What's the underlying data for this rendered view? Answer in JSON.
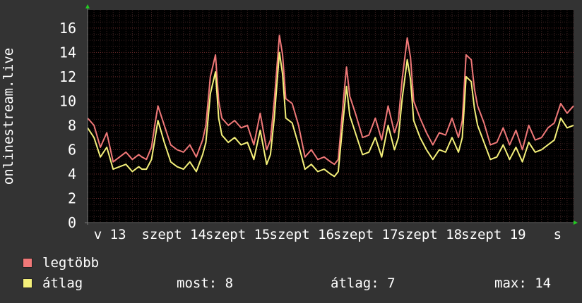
{
  "chart_data": {
    "type": "line",
    "ylabel": "onlinestream.live",
    "ylim": [
      0,
      17.5
    ],
    "yticks": [
      0,
      2,
      4,
      6,
      8,
      10,
      12,
      14,
      16
    ],
    "xlim": [
      0,
      7.6
    ],
    "xtick_labels": [
      {
        "x": 0.35,
        "label": "v 13"
      },
      {
        "x": 1.35,
        "label": "szept 14"
      },
      {
        "x": 2.35,
        "label": "szept 15"
      },
      {
        "x": 3.35,
        "label": "szept 16"
      },
      {
        "x": 4.35,
        "label": "szept 17"
      },
      {
        "x": 5.35,
        "label": "szept 18"
      },
      {
        "x": 6.35,
        "label": "szept 19"
      },
      {
        "x": 7.35,
        "label": "s"
      }
    ],
    "grid": true,
    "series": [
      {
        "name": "legtöbb",
        "color": "#f07878",
        "x": [
          0.0,
          0.1,
          0.2,
          0.3,
          0.4,
          0.5,
          0.6,
          0.7,
          0.8,
          0.85,
          0.92,
          1.0,
          1.05,
          1.1,
          1.2,
          1.3,
          1.4,
          1.5,
          1.6,
          1.7,
          1.8,
          1.85,
          1.92,
          2.0,
          2.05,
          2.1,
          2.2,
          2.3,
          2.4,
          2.5,
          2.6,
          2.7,
          2.8,
          2.86,
          2.92,
          3.0,
          3.05,
          3.1,
          3.2,
          3.3,
          3.4,
          3.5,
          3.6,
          3.7,
          3.8,
          3.86,
          3.92,
          4.0,
          4.05,
          4.1,
          4.2,
          4.3,
          4.4,
          4.5,
          4.6,
          4.7,
          4.8,
          4.86,
          4.92,
          5.0,
          5.05,
          5.1,
          5.2,
          5.3,
          5.4,
          5.5,
          5.6,
          5.7,
          5.8,
          5.86,
          5.92,
          6.0,
          6.05,
          6.1,
          6.2,
          6.3,
          6.4,
          6.5,
          6.6,
          6.7,
          6.8,
          6.9,
          7.0,
          7.1,
          7.2,
          7.3,
          7.4,
          7.5,
          7.6
        ],
        "values": [
          8.6,
          8.0,
          6.2,
          7.4,
          5.0,
          5.4,
          5.8,
          5.2,
          5.6,
          5.4,
          5.2,
          6.2,
          8.0,
          9.6,
          8.0,
          6.4,
          6.0,
          5.8,
          6.4,
          5.4,
          6.8,
          8.0,
          12.0,
          13.8,
          10.0,
          8.6,
          8.0,
          8.4,
          7.8,
          8.0,
          6.4,
          9.0,
          6.0,
          6.8,
          10.0,
          15.4,
          13.8,
          10.2,
          9.8,
          8.0,
          5.4,
          6.0,
          5.2,
          5.4,
          5.0,
          4.8,
          5.2,
          10.0,
          12.8,
          10.4,
          8.8,
          7.0,
          7.2,
          8.6,
          6.8,
          9.6,
          7.4,
          8.4,
          11.8,
          15.2,
          13.6,
          10.0,
          8.6,
          7.4,
          6.4,
          7.4,
          7.2,
          8.6,
          7.0,
          8.4,
          13.8,
          13.4,
          11.0,
          9.6,
          8.2,
          6.4,
          6.6,
          7.8,
          6.4,
          7.6,
          6.0,
          8.0,
          6.8,
          7.0,
          7.8,
          8.2,
          9.8,
          9.0,
          9.6
        ]
      },
      {
        "name": "átlag",
        "color": "#f4f07a",
        "x": [
          0.0,
          0.1,
          0.2,
          0.3,
          0.4,
          0.5,
          0.6,
          0.7,
          0.8,
          0.85,
          0.92,
          1.0,
          1.05,
          1.1,
          1.2,
          1.3,
          1.4,
          1.5,
          1.6,
          1.7,
          1.8,
          1.85,
          1.92,
          2.0,
          2.05,
          2.1,
          2.2,
          2.3,
          2.4,
          2.5,
          2.6,
          2.7,
          2.8,
          2.86,
          2.92,
          3.0,
          3.05,
          3.1,
          3.2,
          3.3,
          3.4,
          3.5,
          3.6,
          3.7,
          3.8,
          3.86,
          3.92,
          4.0,
          4.05,
          4.1,
          4.2,
          4.3,
          4.4,
          4.5,
          4.6,
          4.7,
          4.8,
          4.86,
          4.92,
          5.0,
          5.05,
          5.1,
          5.2,
          5.3,
          5.4,
          5.5,
          5.6,
          5.7,
          5.8,
          5.86,
          5.92,
          6.0,
          6.05,
          6.1,
          6.2,
          6.3,
          6.4,
          6.5,
          6.6,
          6.7,
          6.8,
          6.9,
          7.0,
          7.1,
          7.2,
          7.3,
          7.4,
          7.5,
          7.6
        ],
        "values": [
          7.8,
          7.0,
          5.4,
          6.2,
          4.4,
          4.6,
          4.8,
          4.2,
          4.6,
          4.4,
          4.4,
          5.2,
          6.8,
          8.4,
          6.6,
          5.0,
          4.6,
          4.4,
          5.0,
          4.2,
          5.6,
          6.6,
          10.6,
          12.4,
          8.6,
          7.2,
          6.6,
          7.0,
          6.4,
          6.6,
          5.2,
          7.6,
          4.8,
          5.6,
          8.6,
          14.0,
          12.2,
          8.6,
          8.2,
          6.4,
          4.4,
          4.8,
          4.2,
          4.4,
          4.0,
          3.8,
          4.2,
          8.6,
          11.2,
          8.8,
          7.2,
          5.6,
          5.8,
          7.0,
          5.4,
          8.0,
          6.0,
          7.0,
          10.2,
          13.4,
          11.8,
          8.4,
          7.0,
          6.0,
          5.2,
          6.0,
          5.8,
          7.0,
          5.8,
          7.0,
          12.0,
          11.6,
          9.4,
          8.0,
          6.6,
          5.2,
          5.4,
          6.4,
          5.2,
          6.2,
          5.0,
          6.6,
          5.8,
          6.0,
          6.4,
          6.8,
          8.6,
          7.8,
          8.0
        ]
      }
    ]
  },
  "legend": {
    "items": [
      {
        "label": "legtöbb",
        "color": "#f07878"
      },
      {
        "label": "átlag",
        "color": "#f4f07a"
      }
    ]
  },
  "stats": {
    "now": "most: 8",
    "avg": "átlag: 7",
    "max": "max: 14"
  }
}
